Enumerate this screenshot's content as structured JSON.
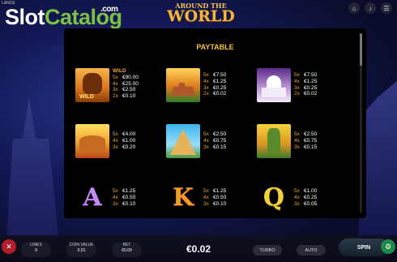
{
  "watermark": {
    "slot": "Slot",
    "catalog": "Catalog",
    "com": ".com"
  },
  "header": {
    "balance_label": "LANCE",
    "logo_line1": "AROUND THE",
    "logo_line2": "WORLD"
  },
  "top_icons": [
    "home-icon",
    "volume-icon",
    "menu-icon"
  ],
  "paytable": {
    "title": "PAYTABLE",
    "symbols": [
      {
        "name": "gorilla",
        "tag": "WILD",
        "wild_label": "WILD",
        "pays": [
          [
            "5x",
            "€90.00"
          ],
          [
            "4x",
            "€25.00"
          ],
          [
            "3x",
            "€2.50"
          ],
          [
            "2x",
            "€0.10"
          ]
        ]
      },
      {
        "name": "great-wall",
        "pays": [
          [
            "5x",
            "€7.50"
          ],
          [
            "4x",
            "€1.25"
          ],
          [
            "3x",
            "€0.25"
          ],
          [
            "2x",
            "€0.02"
          ]
        ]
      },
      {
        "name": "taj-mahal",
        "pays": [
          [
            "5x",
            "€7.50"
          ],
          [
            "4x",
            "€1.25"
          ],
          [
            "3x",
            "€0.25"
          ],
          [
            "2x",
            "€0.02"
          ]
        ]
      },
      {
        "name": "colosseum",
        "pays": [
          [
            "5x",
            "€4.00"
          ],
          [
            "4x",
            "€1.00"
          ],
          [
            "3x",
            "€0.20"
          ]
        ]
      },
      {
        "name": "pyramid",
        "pays": [
          [
            "5x",
            "€2.50"
          ],
          [
            "4x",
            "€0.75"
          ],
          [
            "3x",
            "€0.15"
          ]
        ]
      },
      {
        "name": "moai",
        "pays": [
          [
            "5x",
            "€2.50"
          ],
          [
            "4x",
            "€0.75"
          ],
          [
            "3x",
            "€0.15"
          ]
        ]
      },
      {
        "name": "letter-a",
        "letter": "A",
        "pays": [
          [
            "5x",
            "€1.25"
          ],
          [
            "4x",
            "€0.50"
          ],
          [
            "3x",
            "€0.10"
          ]
        ]
      },
      {
        "name": "letter-k",
        "letter": "K",
        "pays": [
          [
            "5x",
            "€1.25"
          ],
          [
            "4x",
            "€0.50"
          ],
          [
            "3x",
            "€0.10"
          ]
        ]
      },
      {
        "name": "letter-q",
        "letter": "Q",
        "pays": [
          [
            "5x",
            "€1.00"
          ],
          [
            "4x",
            "€0.25"
          ],
          [
            "3x",
            "€0.05"
          ]
        ]
      }
    ]
  },
  "bottom": {
    "lines_label": "LINES",
    "lines_value": "9",
    "coin_label": "COIN VALUE",
    "coin_value": "0.01",
    "bet_label": "BET",
    "bet_value": "€0.09",
    "win": "€0.02",
    "turbo": "TURBO",
    "auto": "AUTO",
    "spin": "SPIN"
  },
  "colors": {
    "accent": "#f2c23a",
    "multiplier": "#f2a33a",
    "panel": "#000000",
    "brand_green": "#7cc242"
  }
}
